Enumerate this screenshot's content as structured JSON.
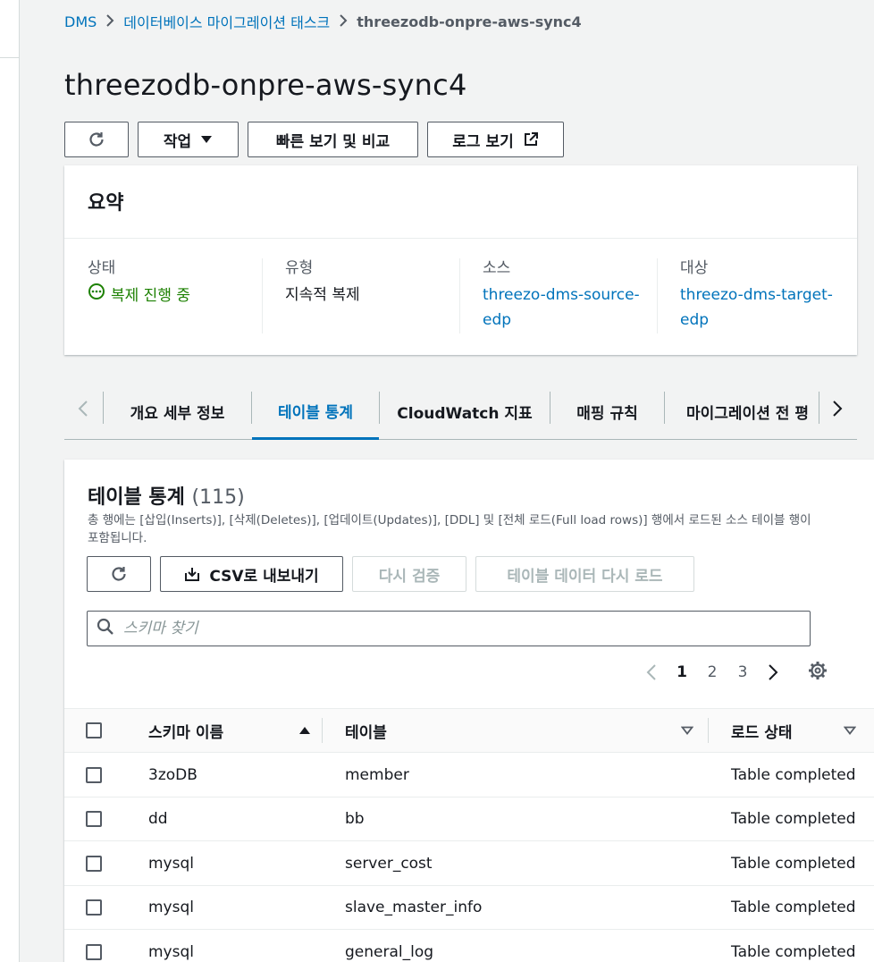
{
  "breadcrumb": {
    "items": [
      "DMS",
      "데이터베이스 마이그레이션 태스크"
    ],
    "current": "threezodb-onpre-aws-sync4"
  },
  "page": {
    "title": "threezodb-onpre-aws-sync4"
  },
  "toolbar": {
    "actions_label": "작업",
    "quick_view_label": "빠른 보기 및 비교",
    "view_logs_label": "로그 보기"
  },
  "summary": {
    "title": "요약",
    "status_label": "상태",
    "status_value": "복제 진행 중",
    "type_label": "유형",
    "type_value": "지속적 복제",
    "source_label": "소스",
    "source_value_1": "threezo-dms-source-",
    "source_value_2": "edp",
    "target_label": "대상",
    "target_value_1": "threezo-dms-target-",
    "target_value_2": "edp"
  },
  "tabs": {
    "items": [
      "개요 세부 정보",
      "테이블 통계",
      "CloudWatch 지표",
      "매핑 규칙",
      "마이그레이션 전 평"
    ],
    "active_index": 1
  },
  "table_stats": {
    "title": "테이블 통계",
    "count": "(115)",
    "description": "총 행에는 [삽입(Inserts)], [삭제(Deletes)], [업데이트(Updates)], [DDL] 및 [전체 로드(Full load rows)] 행에서 로드된 소스 테이블 행이 포함됩니다.",
    "export_csv_label": "CSV로 내보내기",
    "revalidate_label": "다시 검증",
    "reload_label": "테이블 데이터 다시 로드",
    "search_placeholder": "스키마 찾기",
    "pagination": {
      "pages": [
        "1",
        "2",
        "3"
      ],
      "current": "1"
    },
    "columns": [
      "스키마 이름",
      "테이블",
      "로드 상태"
    ],
    "rows": [
      {
        "schema": "3zoDB",
        "table": "member",
        "status": "Table completed"
      },
      {
        "schema": "dd",
        "table": "bb",
        "status": "Table completed"
      },
      {
        "schema": "mysql",
        "table": "server_cost",
        "status": "Table completed"
      },
      {
        "schema": "mysql",
        "table": "slave_master_info",
        "status": "Table completed"
      },
      {
        "schema": "mysql",
        "table": "general_log",
        "status": "Table completed"
      }
    ]
  },
  "icons": {
    "refresh": "refresh-icon",
    "dropdown": "caret-down-icon",
    "external": "external-link-icon",
    "status": "in-progress-icon",
    "download": "download-icon",
    "search": "search-icon",
    "settings": "gear-icon",
    "sort_asc": "sort-ascending-icon",
    "sort": "sort-icon"
  },
  "colors": {
    "link": "#0073bb",
    "status_in_progress": "#1d8102",
    "text": "#16191f",
    "secondary_text": "#545b64"
  }
}
